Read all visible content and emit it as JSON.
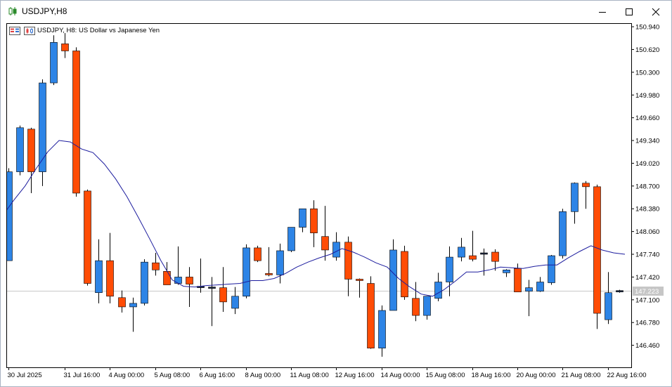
{
  "window": {
    "title": "USDJPY,H8",
    "buttons": {
      "minimize": "minimize-icon",
      "maximize": "maximize-icon",
      "close": "close-icon"
    }
  },
  "chart_data": {
    "type": "candlestick",
    "caption": "USDJPY, H8:  US Dollar vs Japanese Yen",
    "current_price_label": "147.223",
    "current_price": 147.223,
    "ylim": [
      146.15,
      150.99
    ],
    "y_ticks": [
      "150.940",
      "150.620",
      "150.300",
      "149.980",
      "149.660",
      "149.340",
      "149.020",
      "148.700",
      "148.380",
      "148.060",
      "147.740",
      "147.420",
      "147.100",
      "146.780",
      "146.460"
    ],
    "x_ticks": [
      {
        "label": "30 Jul 2025",
        "index": 0
      },
      {
        "label": "31 Jul 16:00",
        "index": 5
      },
      {
        "label": "4 Aug 00:00",
        "index": 9
      },
      {
        "label": "5 Aug 08:00",
        "index": 13
      },
      {
        "label": "6 Aug 16:00",
        "index": 17
      },
      {
        "label": "8 Aug 00:00",
        "index": 21
      },
      {
        "label": "11 Aug 08:00",
        "index": 25
      },
      {
        "label": "12 Aug 16:00",
        "index": 29
      },
      {
        "label": "14 Aug 00:00",
        "index": 33
      },
      {
        "label": "15 Aug 08:00",
        "index": 37
      },
      {
        "label": "18 Aug 16:00",
        "index": 41
      },
      {
        "label": "20 Aug 00:00",
        "index": 45
      },
      {
        "label": "21 Aug 08:00",
        "index": 49
      },
      {
        "label": "22 Aug 16:00",
        "index": 53
      }
    ],
    "colors": {
      "bull": "#2d84e6",
      "bear": "#ff4c05",
      "doji": "#1e2a44",
      "ma": "#1c1c9e",
      "wick": "#000000",
      "grid": "#c9c9c9"
    },
    "candles": [
      {
        "o": 147.65,
        "h": 148.95,
        "l": 147.65,
        "c": 148.9
      },
      {
        "o": 148.9,
        "h": 149.55,
        "l": 148.85,
        "c": 149.52
      },
      {
        "o": 149.5,
        "h": 149.52,
        "l": 148.6,
        "c": 148.9
      },
      {
        "o": 148.9,
        "h": 150.2,
        "l": 148.7,
        "c": 150.15
      },
      {
        "o": 150.15,
        "h": 150.82,
        "l": 150.12,
        "c": 150.72
      },
      {
        "o": 150.7,
        "h": 150.85,
        "l": 150.5,
        "c": 150.6
      },
      {
        "o": 150.6,
        "h": 150.65,
        "l": 148.55,
        "c": 148.6
      },
      {
        "o": 148.63,
        "h": 148.65,
        "l": 147.3,
        "c": 147.33
      },
      {
        "o": 147.2,
        "h": 147.95,
        "l": 147.05,
        "c": 147.65
      },
      {
        "o": 147.65,
        "h": 148.04,
        "l": 147.05,
        "c": 147.15
      },
      {
        "o": 147.13,
        "h": 147.23,
        "l": 146.92,
        "c": 147.0
      },
      {
        "o": 147.0,
        "h": 147.13,
        "l": 146.65,
        "c": 147.05
      },
      {
        "o": 147.05,
        "h": 147.67,
        "l": 147.02,
        "c": 147.63
      },
      {
        "o": 147.62,
        "h": 147.76,
        "l": 147.44,
        "c": 147.52
      },
      {
        "o": 147.5,
        "h": 147.63,
        "l": 147.34,
        "c": 147.31
      },
      {
        "o": 147.33,
        "h": 147.85,
        "l": 147.31,
        "c": 147.42
      },
      {
        "o": 147.42,
        "h": 147.56,
        "l": 147.0,
        "c": 147.32
      },
      {
        "o": 147.28,
        "h": 147.68,
        "l": 147.2,
        "c": 147.28
      },
      {
        "o": 147.27,
        "h": 147.42,
        "l": 146.73,
        "c": 147.27
      },
      {
        "o": 147.27,
        "h": 147.56,
        "l": 146.93,
        "c": 147.07
      },
      {
        "o": 146.98,
        "h": 147.28,
        "l": 146.9,
        "c": 147.15
      },
      {
        "o": 147.15,
        "h": 147.88,
        "l": 147.12,
        "c": 147.83
      },
      {
        "o": 147.83,
        "h": 147.86,
        "l": 147.63,
        "c": 147.65
      },
      {
        "o": 147.47,
        "h": 147.84,
        "l": 147.43,
        "c": 147.45
      },
      {
        "o": 147.45,
        "h": 147.89,
        "l": 147.33,
        "c": 147.79
      },
      {
        "o": 147.79,
        "h": 148.12,
        "l": 147.77,
        "c": 148.12
      },
      {
        "o": 148.12,
        "h": 148.35,
        "l": 148.05,
        "c": 148.38
      },
      {
        "o": 148.38,
        "h": 148.5,
        "l": 147.84,
        "c": 148.04
      },
      {
        "o": 147.99,
        "h": 148.42,
        "l": 147.65,
        "c": 147.8
      },
      {
        "o": 147.7,
        "h": 148.05,
        "l": 147.65,
        "c": 147.91
      },
      {
        "o": 147.91,
        "h": 147.99,
        "l": 147.15,
        "c": 147.39
      },
      {
        "o": 147.39,
        "h": 147.4,
        "l": 147.13,
        "c": 147.37
      },
      {
        "o": 147.33,
        "h": 147.43,
        "l": 146.41,
        "c": 146.42
      },
      {
        "o": 146.42,
        "h": 147.02,
        "l": 146.3,
        "c": 146.95
      },
      {
        "o": 146.95,
        "h": 147.95,
        "l": 146.95,
        "c": 147.8
      },
      {
        "o": 147.78,
        "h": 147.86,
        "l": 147.1,
        "c": 147.14
      },
      {
        "o": 147.12,
        "h": 147.35,
        "l": 146.8,
        "c": 146.88
      },
      {
        "o": 146.88,
        "h": 147.14,
        "l": 146.82,
        "c": 147.15
      },
      {
        "o": 147.12,
        "h": 147.48,
        "l": 147.08,
        "c": 147.35
      },
      {
        "o": 147.35,
        "h": 147.85,
        "l": 147.15,
        "c": 147.7
      },
      {
        "o": 147.7,
        "h": 147.97,
        "l": 147.64,
        "c": 147.84
      },
      {
        "o": 147.72,
        "h": 148.07,
        "l": 147.64,
        "c": 147.67
      },
      {
        "o": 147.74,
        "h": 147.82,
        "l": 147.44,
        "c": 147.75
      },
      {
        "o": 147.77,
        "h": 147.81,
        "l": 147.51,
        "c": 147.64
      },
      {
        "o": 147.48,
        "h": 147.53,
        "l": 147.42,
        "c": 147.52
      },
      {
        "o": 147.54,
        "h": 147.61,
        "l": 147.21,
        "c": 147.21
      },
      {
        "o": 147.22,
        "h": 147.38,
        "l": 146.87,
        "c": 147.27
      },
      {
        "o": 147.22,
        "h": 147.42,
        "l": 147.21,
        "c": 147.35
      },
      {
        "o": 147.34,
        "h": 147.73,
        "l": 147.31,
        "c": 147.72
      },
      {
        "o": 147.72,
        "h": 148.38,
        "l": 147.68,
        "c": 148.34
      },
      {
        "o": 148.34,
        "h": 148.75,
        "l": 148.17,
        "c": 148.74
      },
      {
        "o": 148.74,
        "h": 148.77,
        "l": 148.38,
        "c": 148.69
      },
      {
        "o": 148.69,
        "h": 148.72,
        "l": 146.69,
        "c": 146.91
      },
      {
        "o": 146.82,
        "h": 147.49,
        "l": 146.76,
        "c": 147.2
      },
      {
        "o": 147.21,
        "h": 147.24,
        "l": 147.2,
        "c": 147.22
      }
    ],
    "ma": [
      148.28,
      148.5,
      148.7,
      148.95,
      149.18,
      149.34,
      149.32,
      149.22,
      149.17,
      149.01,
      148.8,
      148.55,
      148.26,
      147.96,
      147.65,
      147.38,
      147.29,
      147.28,
      147.3,
      147.31,
      147.32,
      147.33,
      147.37,
      147.37,
      147.4,
      147.47,
      147.56,
      147.63,
      147.69,
      147.74,
      147.82,
      147.77,
      147.7,
      147.62,
      147.56,
      147.4,
      147.28,
      147.18,
      147.15,
      147.24,
      147.36,
      147.49,
      147.49,
      147.52,
      147.56,
      147.55,
      147.54,
      147.57,
      147.59,
      147.59,
      147.69,
      147.78,
      147.86,
      147.8,
      147.76,
      147.74
    ]
  }
}
